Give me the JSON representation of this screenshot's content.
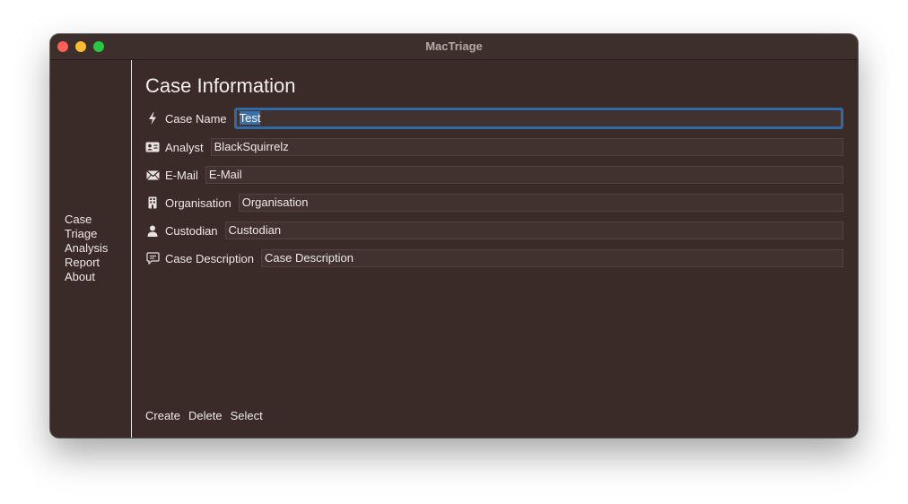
{
  "window": {
    "title": "MacTriage"
  },
  "sidebar": {
    "items": [
      {
        "label": "Case"
      },
      {
        "label": "Triage"
      },
      {
        "label": "Analysis"
      },
      {
        "label": "Report"
      },
      {
        "label": "About"
      }
    ]
  },
  "main": {
    "heading": "Case Information",
    "fields": [
      {
        "label": "Case Name",
        "icon": "bolt-icon",
        "value": "Test",
        "placeholder": "",
        "focused": true
      },
      {
        "label": "Analyst",
        "icon": "contact-card-icon",
        "value": "BlackSquirrelz",
        "placeholder": ""
      },
      {
        "label": "E-Mail",
        "icon": "envelope-icon",
        "value": "",
        "placeholder": "E-Mail"
      },
      {
        "label": "Organisation",
        "icon": "building-icon",
        "value": "",
        "placeholder": "Organisation"
      },
      {
        "label": "Custodian",
        "icon": "person-icon",
        "value": "",
        "placeholder": "Custodian"
      },
      {
        "label": "Case Description",
        "icon": "speech-bubble-icon",
        "value": "",
        "placeholder": "Case Description"
      }
    ],
    "actions": {
      "create": "Create",
      "delete": "Delete",
      "select": "Select"
    }
  },
  "colors": {
    "background": "#3a2b28",
    "focus_ring": "#2f6aa7",
    "selection": "#3b6fa8",
    "close": "#ff5f57",
    "minimize": "#febc2e",
    "maximize": "#28c840"
  }
}
